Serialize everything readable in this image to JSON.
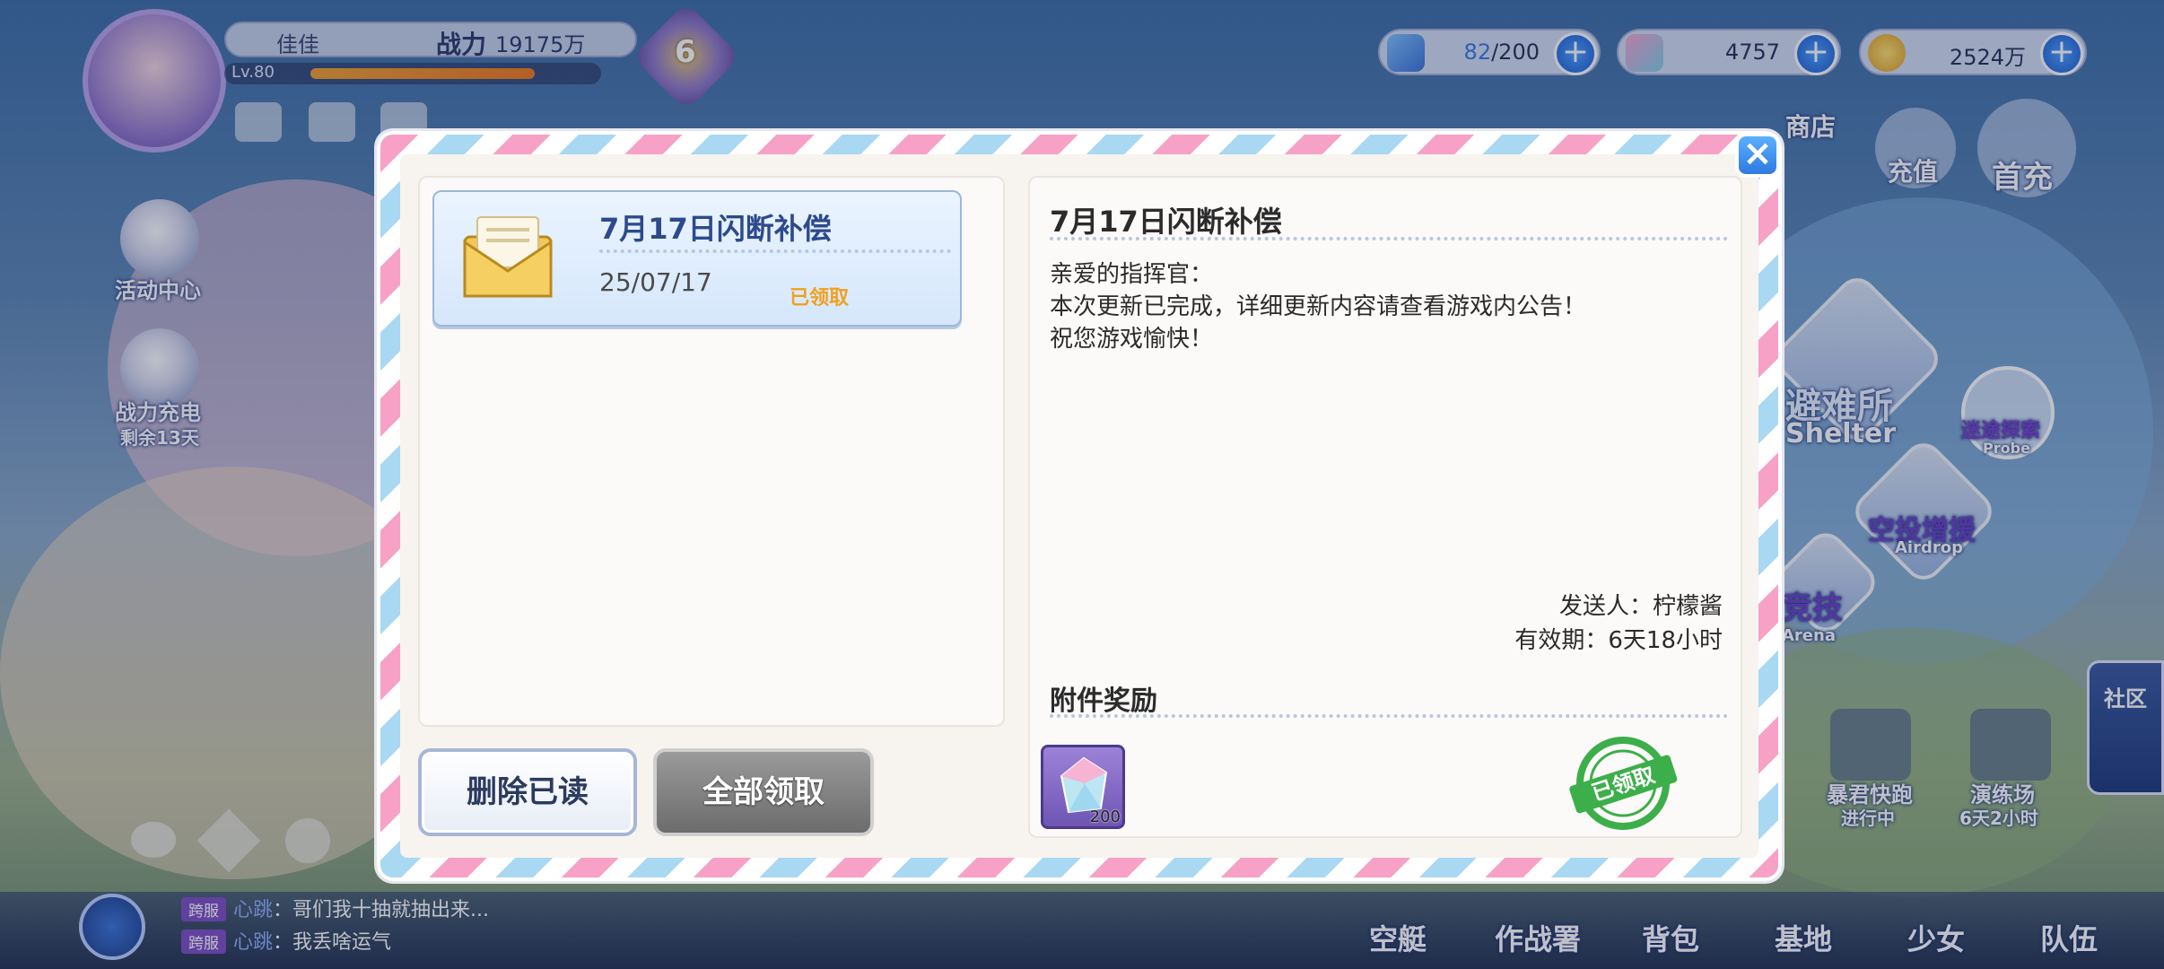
{
  "player": {
    "name": "佳佳",
    "level": "Lv.80",
    "power_label": "战力",
    "power_value": "19175万",
    "rank": "6"
  },
  "currencies": [
    {
      "name": "stamina",
      "current": "82",
      "max": "/200"
    },
    {
      "name": "crystal",
      "value": "4757"
    },
    {
      "name": "gold",
      "value": "2524万"
    }
  ],
  "left_menu": [
    {
      "label": "活动中心"
    },
    {
      "label": "战力充电",
      "sub": "剩余13天"
    }
  ],
  "top_right_menu": [
    "商店",
    "充值",
    "首充"
  ],
  "right_map": [
    {
      "label": "避难所",
      "en": "Shelter"
    },
    {
      "label": "迷途探索",
      "en": "Probe"
    },
    {
      "label": "空投增援",
      "en": "Airdrop"
    },
    {
      "label": "竞技",
      "en": "Arena"
    },
    {
      "label": "暴君快跑",
      "sub": "进行中"
    },
    {
      "label": "演练场",
      "sub": "6天2小时"
    },
    {
      "label": "社区"
    }
  ],
  "bottom_nav": [
    "空艇",
    "作战署",
    "背包",
    "基地",
    "少女",
    "队伍"
  ],
  "chat": [
    {
      "tag": "跨服",
      "user": "心跳",
      "text": "：哥们我十抽就抽出来..."
    },
    {
      "tag": "跨服",
      "user": "心跳",
      "text": "：我丢啥运气"
    }
  ],
  "mail_list": [
    {
      "title": "7月17日闪断补偿",
      "date": "25/07/17",
      "status": "已领取"
    }
  ],
  "buttons": {
    "delete_read": "删除已读",
    "claim_all": "全部领取"
  },
  "mail_detail": {
    "title": "7月17日闪断补偿",
    "lines": [
      "亲爱的指挥官：",
      "本次更新已完成，详细更新内容请查看游戏内公告！",
      "祝您游戏愉快！"
    ],
    "sender_label": "发送人：",
    "sender": "柠檬酱",
    "validity_label": "有效期：",
    "validity": "6天18小时",
    "attachments_title": "附件奖励",
    "attachments": [
      {
        "icon": "crystal-icon",
        "count": "200"
      }
    ],
    "claimed_stamp": "已领取"
  },
  "colors": {
    "accent_blue": "#2f79e0",
    "claimed_orange": "#f0a020",
    "stamp_green": "#3cae4a"
  }
}
